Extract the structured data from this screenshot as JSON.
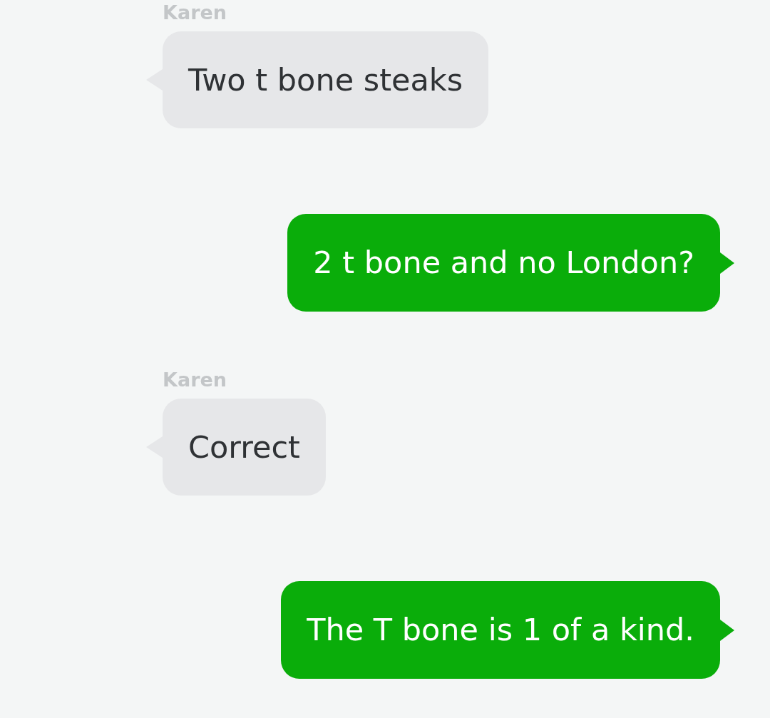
{
  "messages": [
    {
      "kind": "incoming",
      "sender": "Karen",
      "text": "Two t bone steaks"
    },
    {
      "kind": "outgoing",
      "text": "2 t bone and no London?"
    },
    {
      "kind": "incoming",
      "sender": "Karen",
      "text": "Correct"
    },
    {
      "kind": "outgoing",
      "text": "The T bone is 1 of a kind."
    }
  ]
}
